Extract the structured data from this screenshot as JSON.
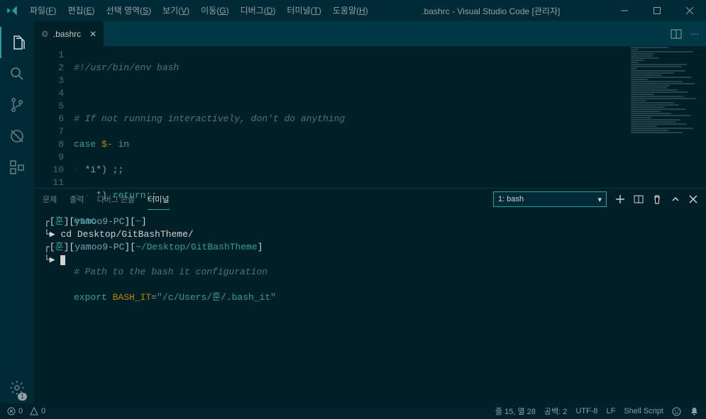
{
  "titlebar": {
    "menus": [
      {
        "label": "파일",
        "accel": "F"
      },
      {
        "label": "편집",
        "accel": "E"
      },
      {
        "label": "선택 영역",
        "accel": "S"
      },
      {
        "label": "보기",
        "accel": "V"
      },
      {
        "label": "이동",
        "accel": "G"
      },
      {
        "label": "디버그",
        "accel": "D"
      },
      {
        "label": "터미널",
        "accel": "T"
      },
      {
        "label": "도움말",
        "accel": "H"
      }
    ],
    "title": ".bashrc - Visual Studio Code [관리자]"
  },
  "tab": {
    "icon": "⚙",
    "filename": ".bashrc"
  },
  "gutter_lines": [
    "1",
    "2",
    "3",
    "4",
    "5",
    "6",
    "7",
    "8",
    "9",
    "10",
    "11"
  ],
  "code": {
    "l1_shebang": "#!/usr/bin/env bash",
    "l3_comment": "# If not running interactively, don't do anything",
    "l4_case": "case",
    "l4_var": "$-",
    "l4_in": "in",
    "l5_pat": "*i*",
    "l5_close": ")",
    "l5_semi": ";;",
    "l6_pat": "*",
    "l6_close": ")",
    "l6_ret": "return",
    "l6_semi": ";;",
    "l7_esac": "esac",
    "l9_comment": "# Path to the bash it configuration",
    "l10_export": "export",
    "l10_var": "BASH_IT",
    "l10_eq": "=",
    "l10_str": "\"/c/Users/훈/.bash_it\""
  },
  "panel": {
    "tabs": [
      "문제",
      "출력",
      "디버그 콘솔",
      "터미널"
    ],
    "active_tab_index": 3,
    "terminal_selector": "1: bash"
  },
  "terminal": {
    "p1_user": "훈",
    "p1_host": "yamoo9-PC",
    "p1_path": "~",
    "cmd1": "cd Desktop/GitBashTheme/",
    "p2_user": "훈",
    "p2_host": "yamoo9-PC",
    "p2_path": "~/Desktop/GitBashTheme"
  },
  "statusbar": {
    "errors": "0",
    "warnings": "0",
    "lncol": "줄 15, 열 28",
    "spaces": "공백: 2",
    "encoding": "UTF-8",
    "eol": "LF",
    "lang": "Shell Script"
  },
  "gear_badge": "1"
}
